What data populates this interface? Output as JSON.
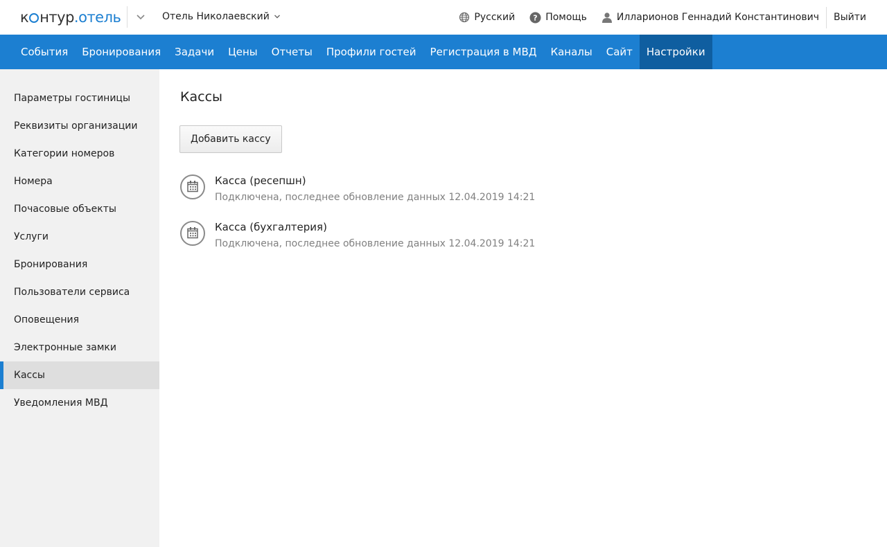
{
  "header": {
    "logo_part1": "к",
    "logo_part2": "нтур",
    "logo_part3": ".отель",
    "hotel": "Отель Николаевский",
    "language": "Русский",
    "help": "Помощь",
    "user": "Илларионов Геннадий Константинович",
    "logout": "Выйти"
  },
  "nav": [
    {
      "label": "События"
    },
    {
      "label": "Бронирования"
    },
    {
      "label": "Задачи"
    },
    {
      "label": "Цены"
    },
    {
      "label": "Отчеты"
    },
    {
      "label": "Профили гостей"
    },
    {
      "label": "Регистрация в МВД"
    },
    {
      "label": "Каналы"
    },
    {
      "label": "Сайт"
    },
    {
      "label": "Настройки",
      "active": true
    }
  ],
  "sidebar": [
    {
      "label": "Параметры гостиницы"
    },
    {
      "label": "Реквизиты организации"
    },
    {
      "label": "Категории номеров"
    },
    {
      "label": "Номера"
    },
    {
      "label": "Почасовые объекты"
    },
    {
      "label": "Услуги"
    },
    {
      "label": "Бронирования"
    },
    {
      "label": "Пользователи сервиса"
    },
    {
      "label": "Оповещения"
    },
    {
      "label": "Электронные замки"
    },
    {
      "label": "Кассы",
      "active": true
    },
    {
      "label": "Уведомления МВД"
    }
  ],
  "main": {
    "title": "Кассы",
    "add_button": "Добавить кассу",
    "registers": [
      {
        "name": "Касса (ресепшн)",
        "status": "Подключена, последнее обновление данных 12.04.2019 14:21"
      },
      {
        "name": "Касса (бухгалтерия)",
        "status": "Подключена, последнее обновление данных 12.04.2019 14:21"
      }
    ]
  },
  "colors": {
    "accent": "#1c7fd1",
    "nav_active": "#0f5ea0",
    "sidebar_bg": "#f1f1f1"
  }
}
